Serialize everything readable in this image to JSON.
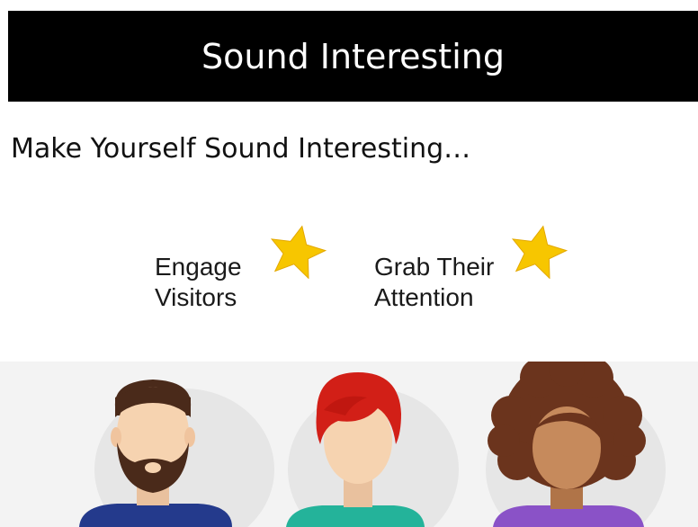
{
  "header": {
    "title": "Sound Interesting"
  },
  "main": {
    "headline": "Make Yourself Sound Interesting…",
    "callouts": [
      {
        "lines": [
          "Engage",
          "Visitors"
        ],
        "icon": "star-icon"
      },
      {
        "lines": [
          "Grab Their",
          "Attention"
        ],
        "icon": "star-icon"
      }
    ]
  },
  "colors": {
    "title_bar": "#000000",
    "title_text": "#ffffff",
    "star": "#f7c600",
    "people_background": "#f3f3f3"
  },
  "illustration": {
    "people": [
      {
        "name": "bearded-man",
        "hair": "#4a2a1a",
        "skin": "#f6d3b0",
        "shirt": "#243a8c"
      },
      {
        "name": "red-haired-woman",
        "hair": "#d21f17",
        "skin": "#f6d3b0",
        "shirt": "#24b39a"
      },
      {
        "name": "curly-haired-woman",
        "hair": "#6b341d",
        "skin": "#c68a5c",
        "shirt": "#8a52c7"
      }
    ]
  }
}
